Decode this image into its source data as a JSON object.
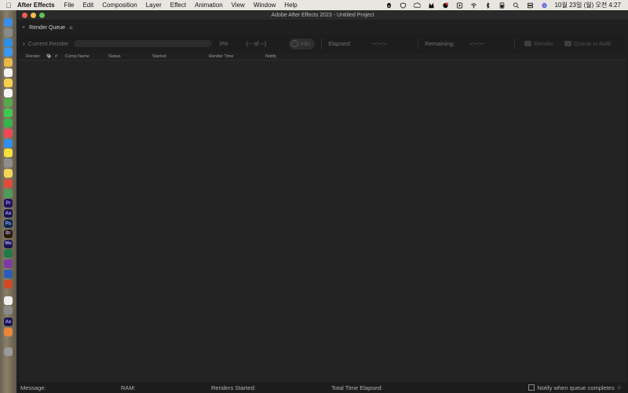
{
  "menubar": {
    "app_name": "After Effects",
    "items": [
      "File",
      "Edit",
      "Composition",
      "Layer",
      "Effect",
      "Animation",
      "View",
      "Window",
      "Help"
    ],
    "clock": "10월 23일 (월) 오전  4:27"
  },
  "window": {
    "title": "Adobe After Effects 2023 - Untitled Project"
  },
  "panel": {
    "tab_title": "Render Queue"
  },
  "render_bar": {
    "current_render_label": "Current Render",
    "progress_percent": 0,
    "progress_text": "0%",
    "of_text": "(-- of --)",
    "info_label": "Info",
    "elapsed_label": "Elapsed:",
    "elapsed_value": "--:--:--",
    "remaining_label": "Remaining:",
    "remaining_value": "--:--:--",
    "render_label": "Render",
    "queue_label": "Queue in AME"
  },
  "columns": {
    "render": "Render",
    "number": "#",
    "comp_name": "Comp Name",
    "status": "Status",
    "started": "Started",
    "render_time": "Render Time",
    "notify": "Notify"
  },
  "statusbar": {
    "message_label": "Message:",
    "ram_label": "RAM:",
    "renders_started_label": "Renders Started:",
    "total_time_label": "Total Time Elapsed:",
    "notify_label": "Notify when queue completes",
    "notify_checked": false
  },
  "dock": {
    "icons": [
      {
        "name": "finder-icon",
        "color": "#3a8ee6",
        "glyph": ""
      },
      {
        "name": "launchpad-icon",
        "color": "#8a8a8a",
        "glyph": ""
      },
      {
        "name": "safari-icon",
        "color": "#2f8ee8",
        "glyph": ""
      },
      {
        "name": "mail-icon",
        "color": "#3b9af0",
        "glyph": ""
      },
      {
        "name": "photos-icon",
        "color": "#e7b94a",
        "glyph": ""
      },
      {
        "name": "calendar-icon",
        "color": "#f2f2f2",
        "glyph": ""
      },
      {
        "name": "notes-icon",
        "color": "#f7d04b",
        "glyph": ""
      },
      {
        "name": "reminders-icon",
        "color": "#f2f2f2",
        "glyph": ""
      },
      {
        "name": "maps-icon",
        "color": "#56a84d",
        "glyph": ""
      },
      {
        "name": "messages-icon",
        "color": "#3ec950",
        "glyph": ""
      },
      {
        "name": "facetime-icon",
        "color": "#36b34a",
        "glyph": ""
      },
      {
        "name": "music-icon",
        "color": "#f04756",
        "glyph": ""
      },
      {
        "name": "appstore-icon",
        "color": "#2e8ff0",
        "glyph": ""
      },
      {
        "name": "kakaotalk-icon",
        "color": "#f7e03c",
        "glyph": ""
      },
      {
        "name": "settings-icon",
        "color": "#8e8e8e",
        "glyph": ""
      },
      {
        "name": "stickies-icon",
        "color": "#f3d65a",
        "glyph": ""
      },
      {
        "name": "chrome-icon",
        "color": "#e04b3a",
        "glyph": ""
      },
      {
        "name": "chrome-alt-icon",
        "color": "#4b9b5a",
        "glyph": ""
      },
      {
        "name": "premiere-icon",
        "color": "#1d1160",
        "glyph": "Pr"
      },
      {
        "name": "after-effects-icon",
        "color": "#1a1650",
        "glyph": "Ae"
      },
      {
        "name": "photoshop-icon",
        "color": "#0b2a4f",
        "glyph": "Ps"
      },
      {
        "name": "bridge-icon",
        "color": "#2a1a06",
        "glyph": "Br"
      },
      {
        "name": "media-encoder-icon",
        "color": "#1a1650",
        "glyph": "Me"
      },
      {
        "name": "excel-icon",
        "color": "#1f7a45",
        "glyph": ""
      },
      {
        "name": "onenote-icon",
        "color": "#7b3aa6",
        "glyph": ""
      },
      {
        "name": "word-icon",
        "color": "#2b5cb8",
        "glyph": ""
      },
      {
        "name": "powerpoint-icon",
        "color": "#d04a26",
        "glyph": ""
      },
      {
        "name": "clock-icon",
        "color": "#efefef",
        "glyph": ""
      },
      {
        "name": "migration-icon",
        "color": "#8a8a8a",
        "glyph": ""
      },
      {
        "name": "after-effects-beta-icon",
        "color": "#1a1650",
        "glyph": "Ae"
      },
      {
        "name": "gallery-icon",
        "color": "#e8863a",
        "glyph": ""
      },
      {
        "name": "trash-icon",
        "color": "#9a9a9a",
        "glyph": ""
      }
    ]
  }
}
